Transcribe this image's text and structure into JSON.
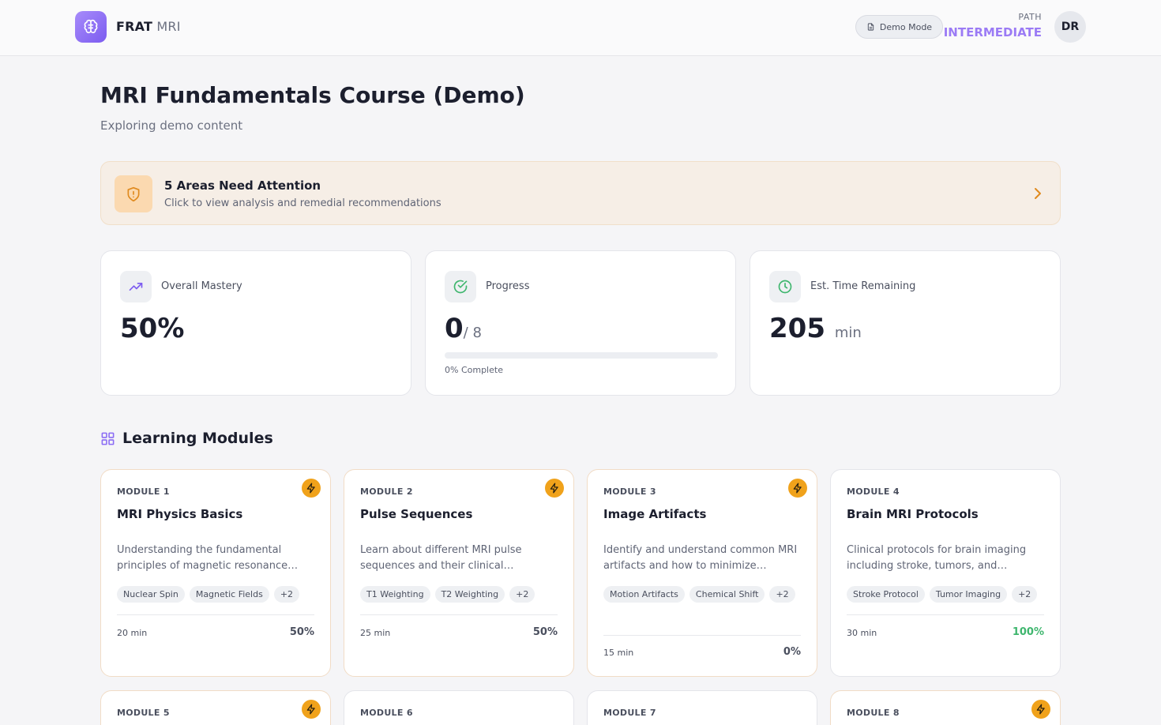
{
  "header": {
    "brand_bold": "FRAT",
    "brand_light": "MRI",
    "demo_label": "Demo Mode",
    "path_label": "PATH",
    "path_value": "INTERMEDIATE",
    "avatar_initials": "DR"
  },
  "page": {
    "title": "MRI Fundamentals Course (Demo)",
    "subtitle": "Exploring demo content"
  },
  "attention": {
    "title": "5 Areas Need Attention",
    "description": "Click to view analysis and remedial recommendations"
  },
  "stats": {
    "mastery": {
      "label": "Overall Mastery",
      "value": "50%"
    },
    "progress": {
      "label": "Progress",
      "value": "0",
      "total": "/ 8",
      "complete_text": "0% Complete",
      "fraction": 0
    },
    "time": {
      "label": "Est. Time Remaining",
      "value": "205",
      "unit": "min"
    }
  },
  "modules_section": {
    "title": "Learning Modules"
  },
  "modules": [
    {
      "number": "MODULE 1",
      "title": "MRI Physics Basics",
      "description": "Understanding the fundamental principles of magnetic resonance…",
      "tags": [
        "Nuclear Spin",
        "Magnetic Fields",
        "+2"
      ],
      "duration": "20 min",
      "percent": "50%"
    },
    {
      "number": "MODULE 2",
      "title": "Pulse Sequences",
      "description": "Learn about different MRI pulse sequences and their clinical…",
      "tags": [
        "T1 Weighting",
        "T2 Weighting",
        "+2"
      ],
      "duration": "25 min",
      "percent": "50%"
    },
    {
      "number": "MODULE 3",
      "title": "Image Artifacts",
      "description": "Identify and understand common MRI artifacts and how to minimize…",
      "tags": [
        "Motion Artifacts",
        "Chemical Shift",
        "+2"
      ],
      "duration": "15 min",
      "percent": "0%"
    },
    {
      "number": "MODULE 4",
      "title": "Brain MRI Protocols",
      "description": "Clinical protocols for brain imaging including stroke, tumors, and…",
      "tags": [
        "Stroke Protocol",
        "Tumor Imaging",
        "+2"
      ],
      "duration": "30 min",
      "percent": "100%"
    },
    {
      "number": "MODULE 5"
    },
    {
      "number": "MODULE 6"
    },
    {
      "number": "MODULE 7"
    },
    {
      "number": "MODULE 8"
    }
  ],
  "colors": {
    "brand_purple": "#7c5cf0",
    "path_purple": "#9b7bf5",
    "bolt_orange": "#f0a21b",
    "success_green": "#3fb66e",
    "attention_bg": "#f6eee6"
  },
  "icons": {
    "logo": "brain-icon",
    "demo": "document-icon",
    "attention": "shield-alert-icon",
    "chevron": "chevron-right-icon",
    "mastery": "trending-up-icon",
    "progress": "check-circle-icon",
    "time": "clock-icon",
    "modules": "grid-icon",
    "module_badge": "lightning-icon"
  }
}
